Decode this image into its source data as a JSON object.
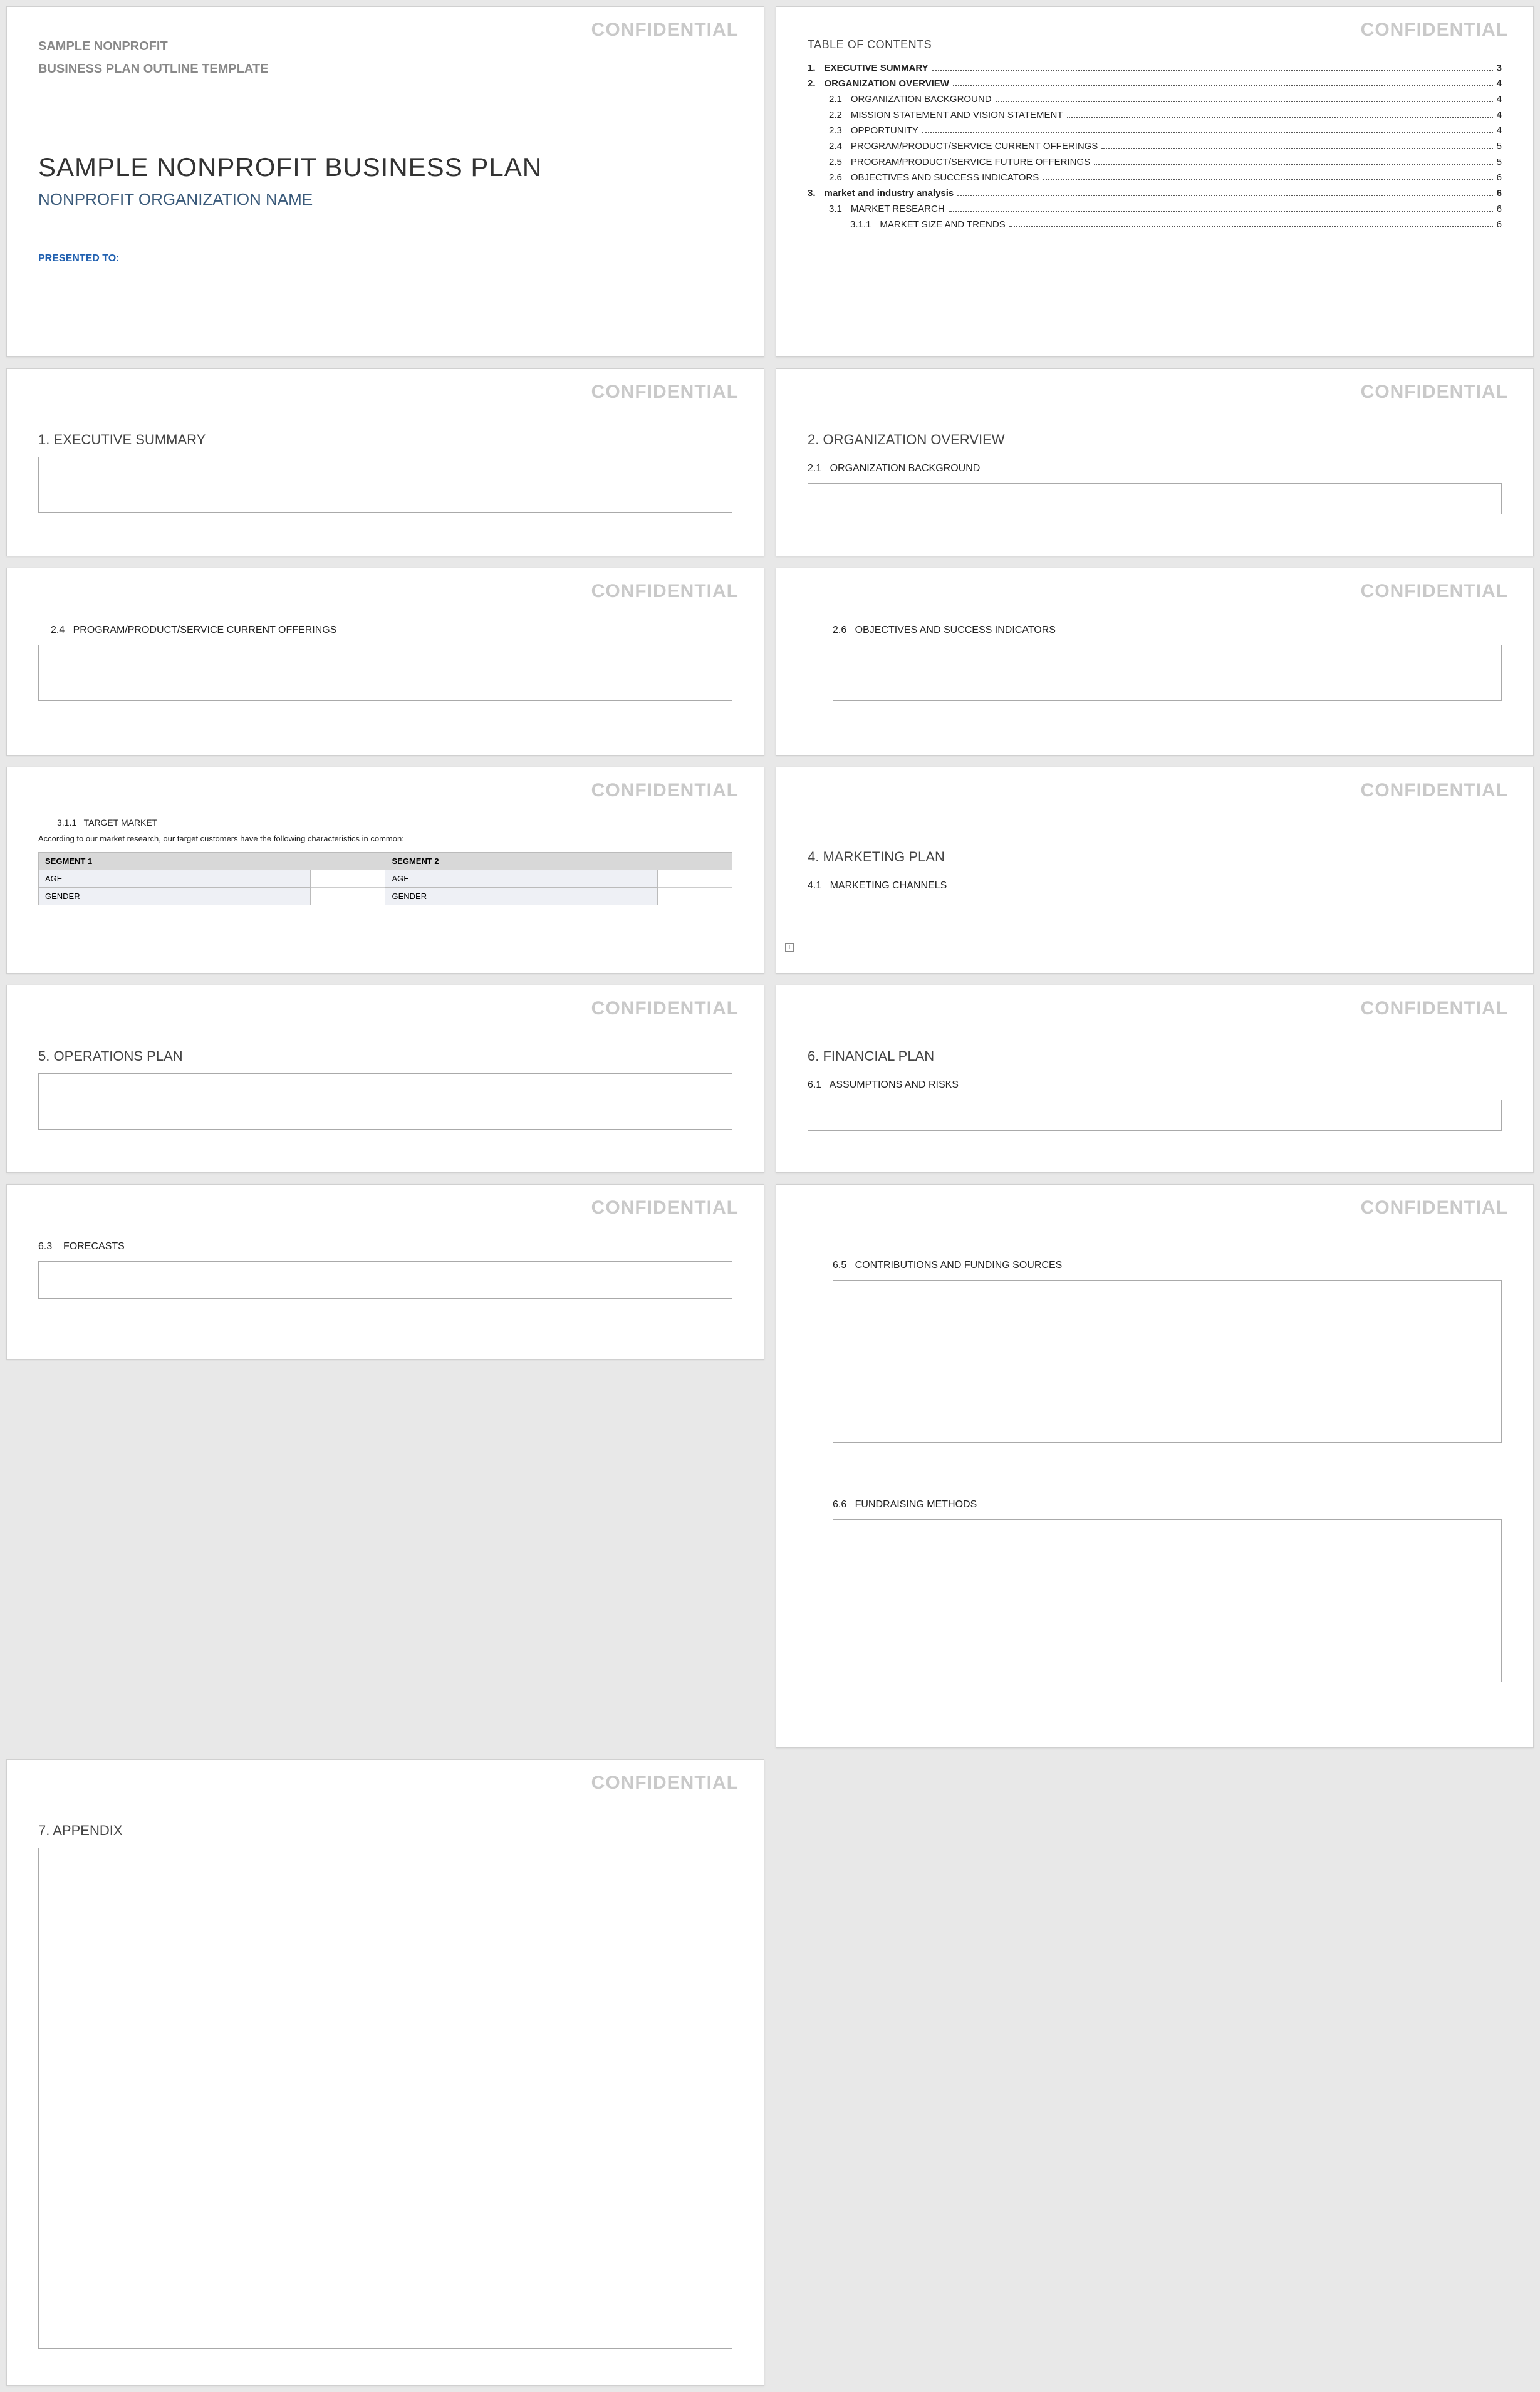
{
  "watermark": "CONFIDENTIAL",
  "page1": {
    "header_line1": "SAMPLE NONPROFIT",
    "header_line2": "BUSINESS PLAN OUTLINE TEMPLATE",
    "title": "SAMPLE NONPROFIT BUSINESS PLAN",
    "subtitle": "NONPROFIT ORGANIZATION NAME",
    "presented_to": "PRESENTED TO:"
  },
  "toc": {
    "title": "TABLE OF CONTENTS",
    "items": [
      {
        "level": 1,
        "num": "1.",
        "text": "EXECUTIVE SUMMARY",
        "page": "3"
      },
      {
        "level": 1,
        "num": "2.",
        "text": "ORGANIZATION OVERVIEW",
        "page": "4"
      },
      {
        "level": 2,
        "num": "2.1",
        "text": "ORGANIZATION BACKGROUND",
        "page": "4"
      },
      {
        "level": 2,
        "num": "2.2",
        "text": "MISSION STATEMENT AND VISION STATEMENT",
        "page": "4"
      },
      {
        "level": 2,
        "num": "2.3",
        "text": "OPPORTUNITY",
        "page": "4"
      },
      {
        "level": 2,
        "num": "2.4",
        "text": "PROGRAM/PRODUCT/SERVICE CURRENT OFFERINGS",
        "page": "5"
      },
      {
        "level": 2,
        "num": "2.5",
        "text": "PROGRAM/PRODUCT/SERVICE FUTURE OFFERINGS",
        "page": "5"
      },
      {
        "level": 2,
        "num": "2.6",
        "text": "OBJECTIVES AND SUCCESS INDICATORS",
        "page": "6"
      },
      {
        "level": 1,
        "num": "3.",
        "text": "market and industry analysis",
        "page": "6"
      },
      {
        "level": 2,
        "num": "3.1",
        "text": "MARKET RESEARCH",
        "page": "6"
      },
      {
        "level": 3,
        "num": "3.1.1",
        "text": "MARKET SIZE AND TRENDS",
        "page": "6"
      }
    ]
  },
  "pages": {
    "p3": {
      "h1": "1. EXECUTIVE SUMMARY"
    },
    "p4": {
      "h1": "2. ORGANIZATION OVERVIEW",
      "h2_num": "2.1",
      "h2_text": "ORGANIZATION BACKGROUND"
    },
    "p5": {
      "h2_num": "2.4",
      "h2_text": "PROGRAM/PRODUCT/SERVICE CURRENT OFFERINGS"
    },
    "p6": {
      "h2_num": "2.6",
      "h2_text": "OBJECTIVES AND SUCCESS INDICATORS"
    },
    "p7": {
      "h3_num": "3.1.1",
      "h3_text": "TARGET MARKET",
      "note": "According to our market research, our target customers have the following characteristics in common:",
      "seg1": "SEGMENT 1",
      "seg2": "SEGMENT 2",
      "row1": "AGE",
      "row2": "GENDER"
    },
    "p8": {
      "h1": "4. MARKETING PLAN",
      "h2_num": "4.1",
      "h2_text": "MARKETING CHANNELS"
    },
    "p9": {
      "h1": "5. OPERATIONS PLAN"
    },
    "p10": {
      "h1": "6. FINANCIAL PLAN",
      "h2_num": "6.1",
      "h2_text": "ASSUMPTIONS AND RISKS"
    },
    "p11": {
      "h2_num": "6.3",
      "h2_text": "FORECASTS"
    },
    "p12": {
      "h2a_num": "6.5",
      "h2a_text": "CONTRIBUTIONS AND FUNDING SOURCES",
      "h2b_num": "6.6",
      "h2b_text": "FUNDRAISING METHODS"
    },
    "p13": {
      "h1": "7. APPENDIX"
    }
  }
}
